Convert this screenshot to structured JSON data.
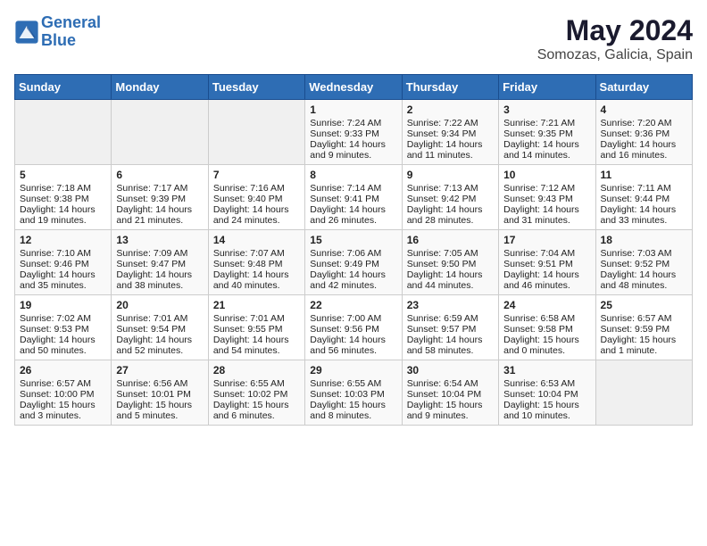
{
  "header": {
    "logo_line1": "General",
    "logo_line2": "Blue",
    "month": "May 2024",
    "location": "Somozas, Galicia, Spain"
  },
  "weekdays": [
    "Sunday",
    "Monday",
    "Tuesday",
    "Wednesday",
    "Thursday",
    "Friday",
    "Saturday"
  ],
  "weeks": [
    [
      {
        "day": "",
        "info": ""
      },
      {
        "day": "",
        "info": ""
      },
      {
        "day": "",
        "info": ""
      },
      {
        "day": "1",
        "info": "Sunrise: 7:24 AM\nSunset: 9:33 PM\nDaylight: 14 hours\nand 9 minutes."
      },
      {
        "day": "2",
        "info": "Sunrise: 7:22 AM\nSunset: 9:34 PM\nDaylight: 14 hours\nand 11 minutes."
      },
      {
        "day": "3",
        "info": "Sunrise: 7:21 AM\nSunset: 9:35 PM\nDaylight: 14 hours\nand 14 minutes."
      },
      {
        "day": "4",
        "info": "Sunrise: 7:20 AM\nSunset: 9:36 PM\nDaylight: 14 hours\nand 16 minutes."
      }
    ],
    [
      {
        "day": "5",
        "info": "Sunrise: 7:18 AM\nSunset: 9:38 PM\nDaylight: 14 hours\nand 19 minutes."
      },
      {
        "day": "6",
        "info": "Sunrise: 7:17 AM\nSunset: 9:39 PM\nDaylight: 14 hours\nand 21 minutes."
      },
      {
        "day": "7",
        "info": "Sunrise: 7:16 AM\nSunset: 9:40 PM\nDaylight: 14 hours\nand 24 minutes."
      },
      {
        "day": "8",
        "info": "Sunrise: 7:14 AM\nSunset: 9:41 PM\nDaylight: 14 hours\nand 26 minutes."
      },
      {
        "day": "9",
        "info": "Sunrise: 7:13 AM\nSunset: 9:42 PM\nDaylight: 14 hours\nand 28 minutes."
      },
      {
        "day": "10",
        "info": "Sunrise: 7:12 AM\nSunset: 9:43 PM\nDaylight: 14 hours\nand 31 minutes."
      },
      {
        "day": "11",
        "info": "Sunrise: 7:11 AM\nSunset: 9:44 PM\nDaylight: 14 hours\nand 33 minutes."
      }
    ],
    [
      {
        "day": "12",
        "info": "Sunrise: 7:10 AM\nSunset: 9:46 PM\nDaylight: 14 hours\nand 35 minutes."
      },
      {
        "day": "13",
        "info": "Sunrise: 7:09 AM\nSunset: 9:47 PM\nDaylight: 14 hours\nand 38 minutes."
      },
      {
        "day": "14",
        "info": "Sunrise: 7:07 AM\nSunset: 9:48 PM\nDaylight: 14 hours\nand 40 minutes."
      },
      {
        "day": "15",
        "info": "Sunrise: 7:06 AM\nSunset: 9:49 PM\nDaylight: 14 hours\nand 42 minutes."
      },
      {
        "day": "16",
        "info": "Sunrise: 7:05 AM\nSunset: 9:50 PM\nDaylight: 14 hours\nand 44 minutes."
      },
      {
        "day": "17",
        "info": "Sunrise: 7:04 AM\nSunset: 9:51 PM\nDaylight: 14 hours\nand 46 minutes."
      },
      {
        "day": "18",
        "info": "Sunrise: 7:03 AM\nSunset: 9:52 PM\nDaylight: 14 hours\nand 48 minutes."
      }
    ],
    [
      {
        "day": "19",
        "info": "Sunrise: 7:02 AM\nSunset: 9:53 PM\nDaylight: 14 hours\nand 50 minutes."
      },
      {
        "day": "20",
        "info": "Sunrise: 7:01 AM\nSunset: 9:54 PM\nDaylight: 14 hours\nand 52 minutes."
      },
      {
        "day": "21",
        "info": "Sunrise: 7:01 AM\nSunset: 9:55 PM\nDaylight: 14 hours\nand 54 minutes."
      },
      {
        "day": "22",
        "info": "Sunrise: 7:00 AM\nSunset: 9:56 PM\nDaylight: 14 hours\nand 56 minutes."
      },
      {
        "day": "23",
        "info": "Sunrise: 6:59 AM\nSunset: 9:57 PM\nDaylight: 14 hours\nand 58 minutes."
      },
      {
        "day": "24",
        "info": "Sunrise: 6:58 AM\nSunset: 9:58 PM\nDaylight: 15 hours\nand 0 minutes."
      },
      {
        "day": "25",
        "info": "Sunrise: 6:57 AM\nSunset: 9:59 PM\nDaylight: 15 hours\nand 1 minute."
      }
    ],
    [
      {
        "day": "26",
        "info": "Sunrise: 6:57 AM\nSunset: 10:00 PM\nDaylight: 15 hours\nand 3 minutes."
      },
      {
        "day": "27",
        "info": "Sunrise: 6:56 AM\nSunset: 10:01 PM\nDaylight: 15 hours\nand 5 minutes."
      },
      {
        "day": "28",
        "info": "Sunrise: 6:55 AM\nSunset: 10:02 PM\nDaylight: 15 hours\nand 6 minutes."
      },
      {
        "day": "29",
        "info": "Sunrise: 6:55 AM\nSunset: 10:03 PM\nDaylight: 15 hours\nand 8 minutes."
      },
      {
        "day": "30",
        "info": "Sunrise: 6:54 AM\nSunset: 10:04 PM\nDaylight: 15 hours\nand 9 minutes."
      },
      {
        "day": "31",
        "info": "Sunrise: 6:53 AM\nSunset: 10:04 PM\nDaylight: 15 hours\nand 10 minutes."
      },
      {
        "day": "",
        "info": ""
      }
    ]
  ]
}
